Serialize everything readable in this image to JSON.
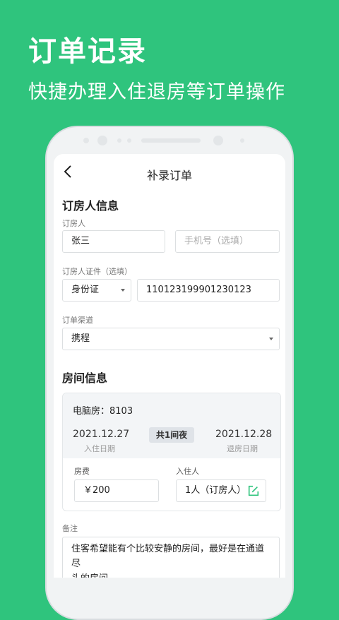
{
  "promo": {
    "title": "订单记录",
    "subtitle": "快捷办理入住退房等订单操作"
  },
  "nav": {
    "title": "补录订单"
  },
  "booker": {
    "section_title": "订房人信息",
    "name_label": "订房人",
    "name_value": "张三",
    "phone_placeholder": "手机号（选填）",
    "id_label": "订房人证件（选填）",
    "id_type": "身份证",
    "id_number": "110123199901230123",
    "channel_label": "订单渠道",
    "channel_value": "携程"
  },
  "room": {
    "section_title": "房间信息",
    "room_name": "电脑房：8103",
    "checkin_date": "2021.12.27",
    "checkin_label": "入住日期",
    "nights": "共1间夜",
    "checkout_date": "2021.12.28",
    "checkout_label": "退房日期",
    "fee_label": "房费",
    "fee_value": "￥200",
    "guest_label": "入住人",
    "guest_value": "1人（订房人）"
  },
  "remark": {
    "label": "备注",
    "value_line1": "住客希望能有个比较安静的房间，最好是在通道尽",
    "value_line2": "头的房间"
  },
  "colors": {
    "brand_green": "#2fc47d",
    "edit_icon": "#2fc47d"
  }
}
